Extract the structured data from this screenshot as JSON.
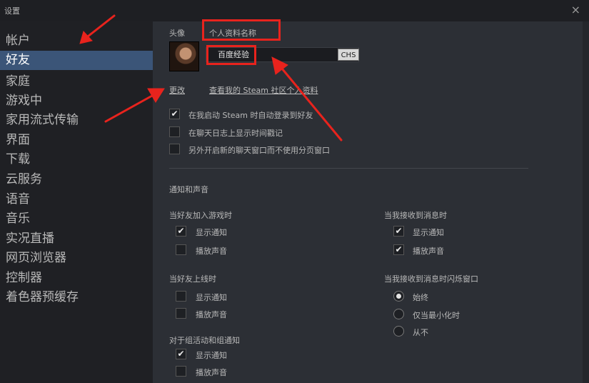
{
  "window": {
    "title": "设置",
    "close_glyph": "×"
  },
  "sidebar": {
    "items": [
      {
        "label": "帐户"
      },
      {
        "label": "好友",
        "active": true
      },
      {
        "label": "家庭"
      },
      {
        "label": "游戏中"
      },
      {
        "label": "家用流式传输"
      },
      {
        "label": "界面"
      },
      {
        "label": "下载"
      },
      {
        "label": "云服务"
      },
      {
        "label": "语音"
      },
      {
        "label": "音乐"
      },
      {
        "label": "实况直播"
      },
      {
        "label": "网页浏览器"
      },
      {
        "label": "控制器"
      },
      {
        "label": "着色器预缓存"
      }
    ]
  },
  "profile": {
    "avatar_label": "头像",
    "name_label": "个人资料名称",
    "name_value": "百度经验",
    "ime_badge": "CHS",
    "change_link": "更改",
    "view_profile_link": "查看我的 Steam 社区个人资料"
  },
  "options": [
    {
      "label": "在我启动 Steam 时自动登录到好友",
      "checked": true
    },
    {
      "label": "在聊天日志上显示时间戳记",
      "checked": false
    },
    {
      "label": "另外开启新的聊天窗口而不使用分页窗口",
      "checked": false
    }
  ],
  "notifications": {
    "section_title": "通知和声音",
    "friend_joins_game": {
      "title": "当好友加入游戏时",
      "items": [
        {
          "label": "显示通知",
          "checked": true
        },
        {
          "label": "播放声音",
          "checked": false
        }
      ]
    },
    "friend_online": {
      "title": "当好友上线时",
      "items": [
        {
          "label": "显示通知",
          "checked": false
        },
        {
          "label": "播放声音",
          "checked": false
        }
      ]
    },
    "group_events": {
      "title": "对于组活动和组通知",
      "items": [
        {
          "label": "显示通知",
          "checked": true
        },
        {
          "label": "播放声音",
          "checked": false
        }
      ]
    },
    "message_received": {
      "title": "当我接收到消息时",
      "items": [
        {
          "label": "显示通知",
          "checked": true
        },
        {
          "label": "播放声音",
          "checked": true
        }
      ]
    },
    "flash_window": {
      "title": "当我接收到消息时闪烁窗口",
      "options": [
        {
          "label": "始终",
          "selected": true
        },
        {
          "label": "仅当最小化时",
          "selected": false
        },
        {
          "label": "从不",
          "selected": false
        }
      ]
    }
  },
  "check_glyph": "✔",
  "colors": {
    "accent_selected": "#3b5578",
    "annotation_red": "#e8231d"
  }
}
